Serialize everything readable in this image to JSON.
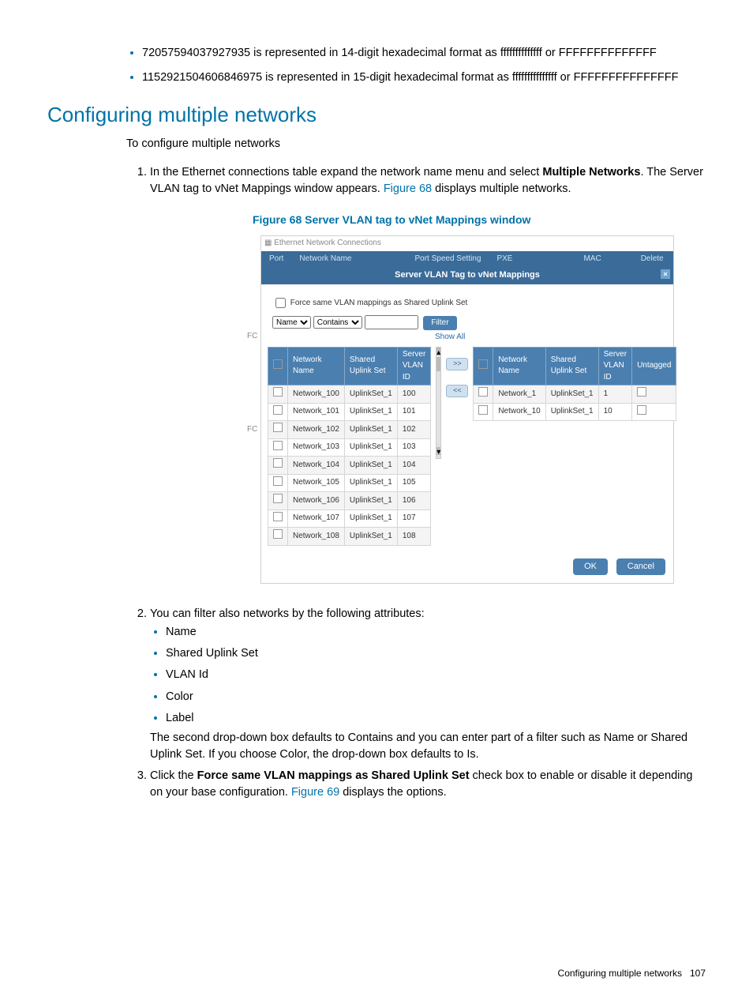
{
  "intro": {
    "b1": "72057594037927935 is represented in 14-digit hexadecimal format as ffffffffffffff or FFFFFFFFFFFFFF",
    "b2": "1152921504606846975 is represented in 15-digit hexadecimal format as fffffffffffffff or FFFFFFFFFFFFFFF"
  },
  "heading": "Configuring multiple networks",
  "lead": "To configure multiple networks",
  "step1_pre": "In the Ethernet connections table expand the network name menu and select ",
  "step1_bold": "Multiple Networks",
  "step1_post": ". The Server VLAN tag to vNet Mappings window appears. ",
  "fig68_link": "Figure 68",
  "step1_tail": " displays multiple networks.",
  "figure_caption": "Figure 68 Server VLAN tag to vNet Mappings window",
  "ss": {
    "win_title": "Ethernet Network Connections",
    "tabs": {
      "port": "Port",
      "netname": "Network Name",
      "pss": "Port Speed Setting",
      "pxe": "PXE",
      "mac": "MAC",
      "delete": "Delete"
    },
    "banner": "Server VLAN Tag to vNet Mappings",
    "close": "×",
    "force_label": "Force same VLAN mappings as Shared Uplink Set",
    "filter_name": "Name",
    "filter_contains": "Contains",
    "filter_btn": "Filter",
    "show_all": "Show All",
    "left_headers": {
      "chk": "",
      "name": "Network Name",
      "sus": "Shared Uplink Set",
      "vlan": "Server VLAN ID"
    },
    "left_rows": [
      {
        "name": "Network_100",
        "sus": "UplinkSet_1",
        "vlan": "100"
      },
      {
        "name": "Network_101",
        "sus": "UplinkSet_1",
        "vlan": "101"
      },
      {
        "name": "Network_102",
        "sus": "UplinkSet_1",
        "vlan": "102"
      },
      {
        "name": "Network_103",
        "sus": "UplinkSet_1",
        "vlan": "103"
      },
      {
        "name": "Network_104",
        "sus": "UplinkSet_1",
        "vlan": "104"
      },
      {
        "name": "Network_105",
        "sus": "UplinkSet_1",
        "vlan": "105"
      },
      {
        "name": "Network_106",
        "sus": "UplinkSet_1",
        "vlan": "106"
      },
      {
        "name": "Network_107",
        "sus": "UplinkSet_1",
        "vlan": "107"
      },
      {
        "name": "Network_108",
        "sus": "UplinkSet_1",
        "vlan": "108"
      }
    ],
    "right_headers": {
      "chk": "",
      "name": "Network Name",
      "sus": "Shared Uplink Set",
      "vlan": "Server VLAN ID",
      "untag": "Untagged"
    },
    "right_rows": [
      {
        "name": "Network_1",
        "sus": "UplinkSet_1",
        "vlan": "1"
      },
      {
        "name": "Network_10",
        "sus": "UplinkSet_1",
        "vlan": "10"
      }
    ],
    "add": ">>",
    "remove": "<<",
    "ok": "OK",
    "cancel": "Cancel",
    "left_crumb_top": "FC",
    "left_crumb_bot": "FC"
  },
  "step2": "You can filter also networks by the following attributes:",
  "attrs": {
    "a1": "Name",
    "a2": "Shared Uplink Set",
    "a3": "VLAN Id",
    "a4": "Color",
    "a5": "Label"
  },
  "step2_tail": "The second drop-down box defaults to Contains and you can enter part of a filter such as Name or Shared Uplink Set. If you choose Color, the drop-down box defaults to Is.",
  "step3_pre": "Click the ",
  "step3_bold": "Force same VLAN mappings as Shared Uplink Set",
  "step3_mid": " check box to enable or disable it depending on your base configuration. ",
  "fig69_link": "Figure 69",
  "step3_tail": " displays the options.",
  "footer": "Configuring multiple networks",
  "pagenum": "107"
}
